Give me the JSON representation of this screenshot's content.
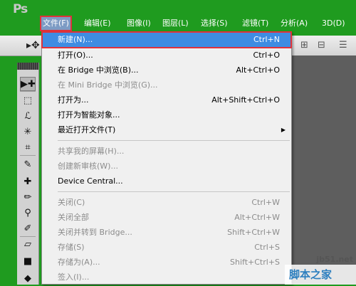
{
  "app": {
    "logo": "Ps",
    "accent": "#3e8ce2",
    "highlight_border": "#e0323a"
  },
  "menubar": [
    {
      "label": "文件(F)",
      "active": true
    },
    {
      "label": "编辑(E)"
    },
    {
      "label": "图像(I)"
    },
    {
      "label": "图层(L)"
    },
    {
      "label": "选择(S)"
    },
    {
      "label": "滤镜(T)"
    },
    {
      "label": "分析(A)"
    },
    {
      "label": "3D(D)"
    }
  ],
  "file_menu": {
    "items": [
      {
        "label": "新建(N)...",
        "shortcut": "Ctrl+N",
        "state": "highlighted"
      },
      {
        "label": "打开(O)...",
        "shortcut": "Ctrl+O"
      },
      {
        "label": "在 Bridge 中浏览(B)...",
        "shortcut": "Alt+Ctrl+O"
      },
      {
        "label": "在 Mini Bridge 中浏览(G)...",
        "shortcut": "",
        "state": "disabled"
      },
      {
        "label": "打开为...",
        "shortcut": "Alt+Shift+Ctrl+O"
      },
      {
        "label": "打开为智能对象..."
      },
      {
        "label": "最近打开文件(T)",
        "submenu": true
      },
      {
        "label": "共享我的屏幕(H)...",
        "state": "disabled"
      },
      {
        "label": "创建新审核(W)...",
        "state": "disabled"
      },
      {
        "label": "Device Central..."
      },
      {
        "label": "关闭(C)",
        "shortcut": "Ctrl+W",
        "state": "disabled"
      },
      {
        "label": "关闭全部",
        "shortcut": "Alt+Ctrl+W",
        "state": "disabled"
      },
      {
        "label": "关闭并转到 Bridge...",
        "shortcut": "Shift+Ctrl+W",
        "state": "disabled"
      },
      {
        "label": "存储(S)",
        "shortcut": "Ctrl+S",
        "state": "disabled"
      },
      {
        "label": "存储为(A)...",
        "shortcut": "Shift+Ctrl+S",
        "state": "disabled"
      },
      {
        "label": "签入(I)...",
        "state": "disabled"
      }
    ]
  },
  "toolbox": {
    "tools": [
      {
        "icon": "move-tool-icon",
        "glyph": "▶✚"
      },
      {
        "icon": "marquee-tool-icon",
        "glyph": "⬚"
      },
      {
        "icon": "lasso-tool-icon",
        "glyph": "ℒ"
      },
      {
        "icon": "quick-select-icon",
        "glyph": "✳"
      },
      {
        "icon": "crop-tool-icon",
        "glyph": "⌗"
      },
      {
        "icon": "eyedropper-icon",
        "glyph": "✎"
      },
      {
        "icon": "healing-brush-icon",
        "glyph": "✚"
      },
      {
        "icon": "brush-tool-icon",
        "glyph": "✏"
      },
      {
        "icon": "clone-stamp-icon",
        "glyph": "⚲"
      },
      {
        "icon": "history-brush-icon",
        "glyph": "✐"
      },
      {
        "icon": "eraser-icon",
        "glyph": "▱"
      },
      {
        "icon": "gradient-icon",
        "glyph": "■"
      },
      {
        "icon": "blur-icon",
        "glyph": "◆"
      }
    ]
  },
  "watermark": {
    "site": "jb51.net",
    "text": "脚本之家"
  }
}
